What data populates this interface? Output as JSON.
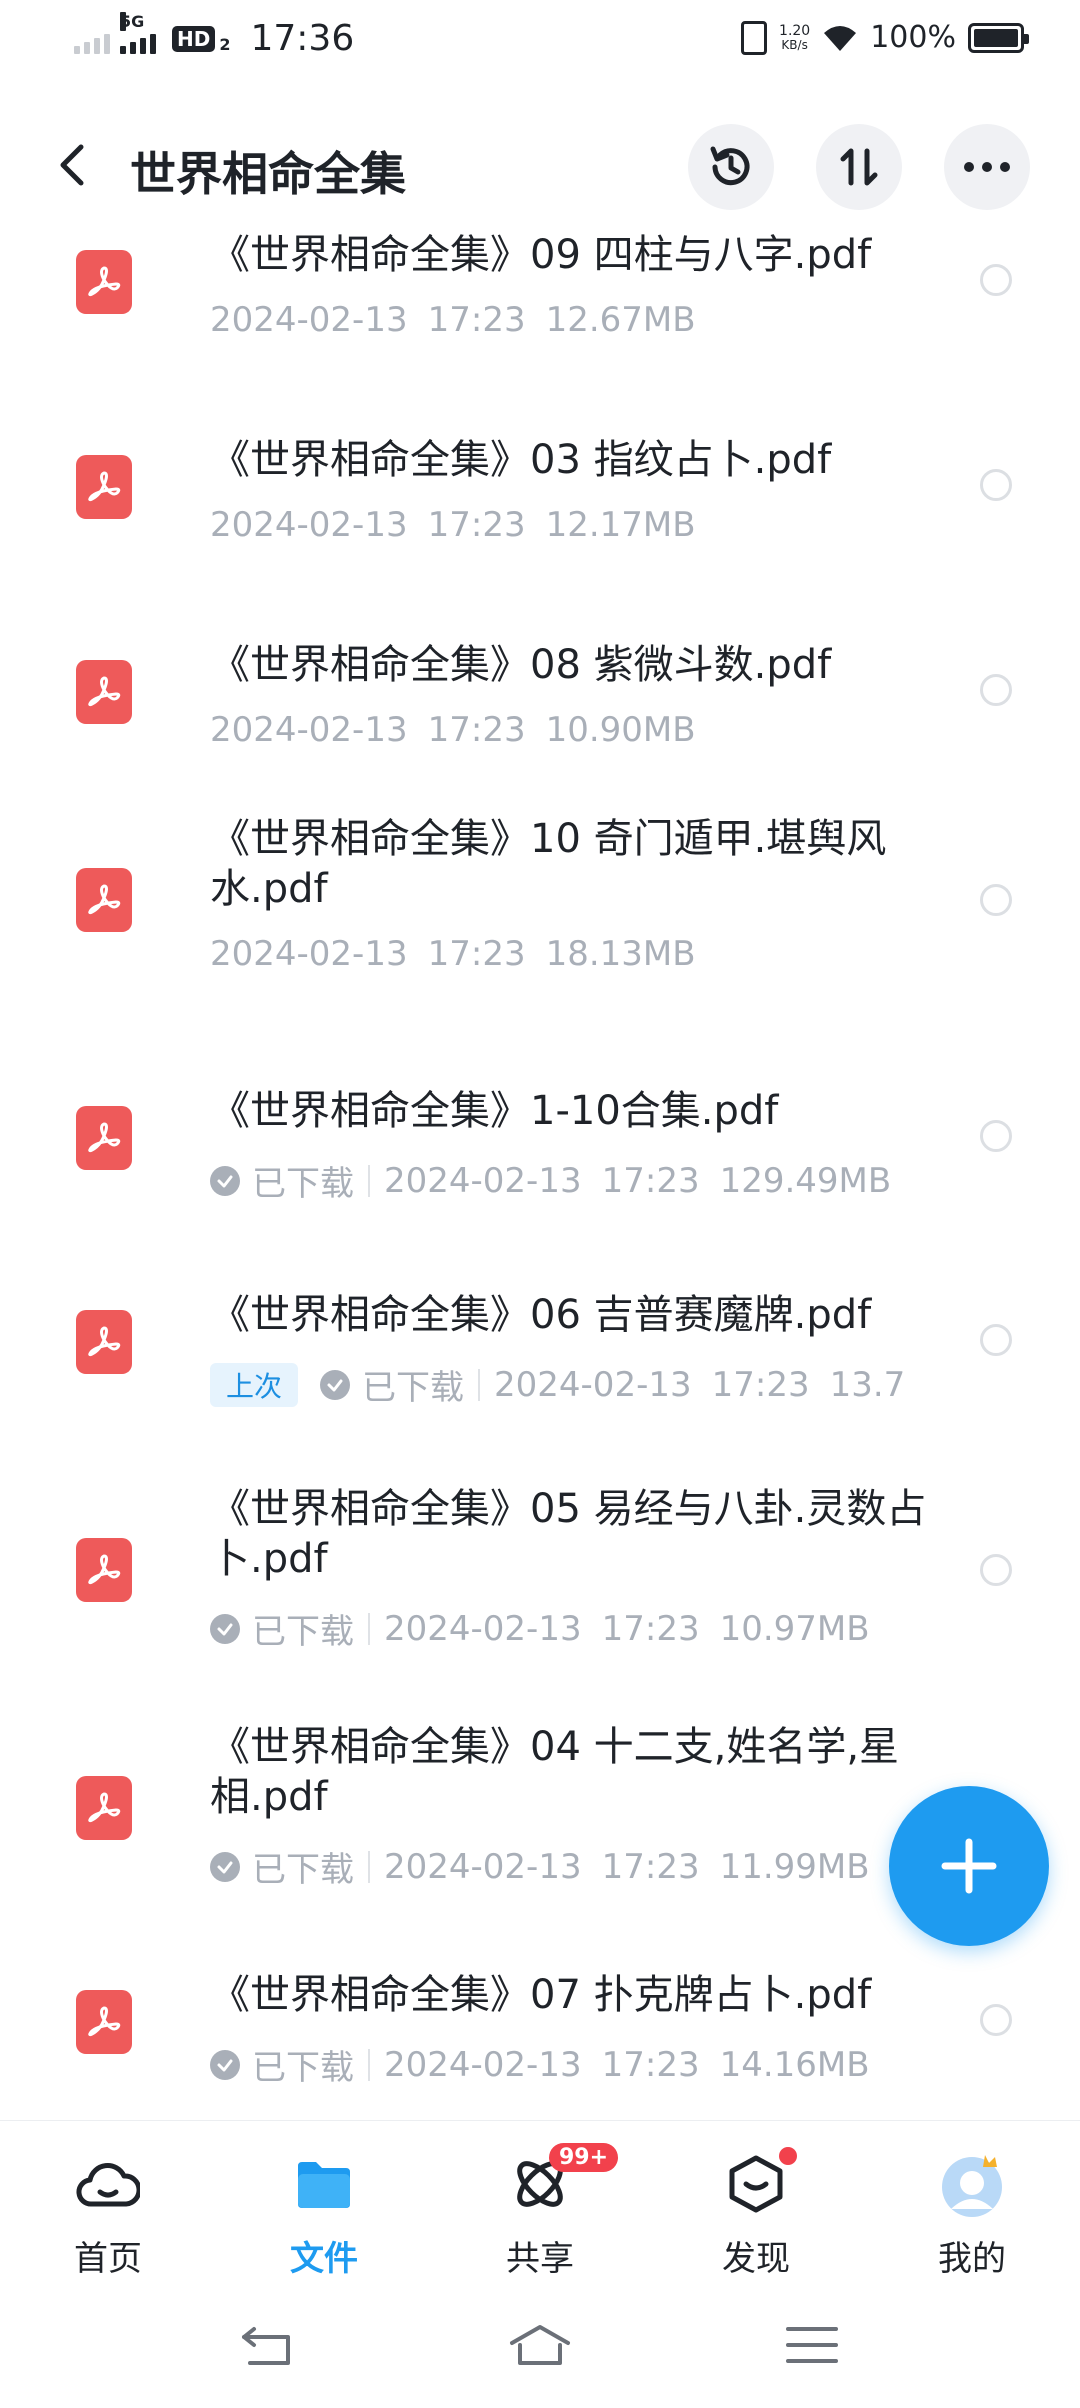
{
  "status_bar": {
    "network": "5G",
    "hd": "HD",
    "hd_sub": "2",
    "time": "17:36",
    "speed_value": "1.20",
    "speed_unit": "KB/s",
    "battery": "100%"
  },
  "header": {
    "title": "世界相命全集"
  },
  "files": [
    {
      "name": "《世界相命全集》09 四柱与八字.pdf",
      "date": "2024-02-13",
      "time": "17:23",
      "size": "12.67MB",
      "downloaded": false,
      "last": false
    },
    {
      "name": "《世界相命全集》03 指纹占卜.pdf",
      "date": "2024-02-13",
      "time": "17:23",
      "size": "12.17MB",
      "downloaded": false,
      "last": false
    },
    {
      "name": "《世界相命全集》08 紫微斗数.pdf",
      "date": "2024-02-13",
      "time": "17:23",
      "size": "10.90MB",
      "downloaded": false,
      "last": false
    },
    {
      "name": "《世界相命全集》10 奇门遁甲.堪舆风水.pdf",
      "date": "2024-02-13",
      "time": "17:23",
      "size": "18.13MB",
      "downloaded": false,
      "last": false
    },
    {
      "name": "《世界相命全集》1-10合集.pdf",
      "date": "2024-02-13",
      "time": "17:23",
      "size": "129.49MB",
      "downloaded": true,
      "last": false
    },
    {
      "name": "《世界相命全集》06 吉普赛魔牌.pdf",
      "date": "2024-02-13",
      "time": "17:23",
      "size": "13.7",
      "downloaded": true,
      "last": true
    },
    {
      "name": "《世界相命全集》05 易经与八卦.灵数占卜.pdf",
      "date": "2024-02-13",
      "time": "17:23",
      "size": "10.97MB",
      "downloaded": true,
      "last": false
    },
    {
      "name": "《世界相命全集》04 十二支,姓名学,星相.pdf",
      "date": "2024-02-13",
      "time": "17:23",
      "size": "11.99MB",
      "downloaded": true,
      "last": false
    },
    {
      "name": "《世界相命全集》07 扑克牌占卜.pdf",
      "date": "2024-02-13",
      "time": "17:23",
      "size": "14.16MB",
      "downloaded": true,
      "last": false
    }
  ],
  "labels": {
    "downloaded": "已下载",
    "last": "上次"
  },
  "bottom_nav": {
    "home": "首页",
    "files": "文件",
    "share": "共享",
    "discover": "发现",
    "mine": "我的",
    "share_badge": "99+"
  },
  "colors": {
    "accent": "#1e9bf0",
    "pdf_red": "#ee5a5a",
    "badge_red": "#f2414c",
    "meta_gray": "#a9afb8"
  }
}
